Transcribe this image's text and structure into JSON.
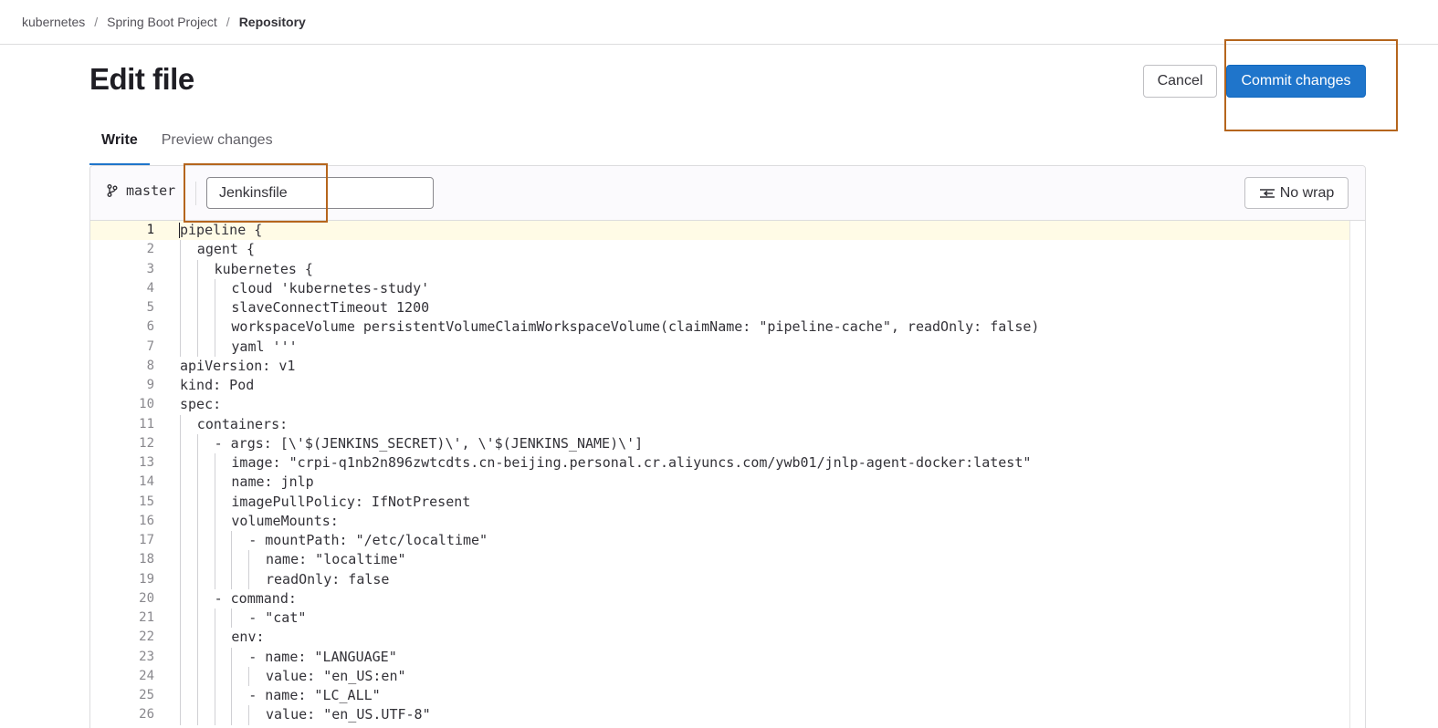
{
  "breadcrumb": {
    "items": [
      "kubernetes",
      "Spring Boot Project"
    ],
    "current": "Repository",
    "separator": "/"
  },
  "page": {
    "title": "Edit file"
  },
  "actions": {
    "cancel_label": "Cancel",
    "commit_label": "Commit changes"
  },
  "tabs": [
    {
      "label": "Write",
      "active": true
    },
    {
      "label": "Preview changes",
      "active": false
    }
  ],
  "editor": {
    "branch_icon": "branch-icon",
    "branch": "master",
    "filename": "Jenkinsfile",
    "wrap_label": "No wrap",
    "wrap_icon": "no-wrap-icon",
    "active_line": 1,
    "lines": [
      {
        "n": "1",
        "indent": 0,
        "text": "pipeline {"
      },
      {
        "n": "2",
        "indent": 1,
        "text": "agent {"
      },
      {
        "n": "3",
        "indent": 2,
        "text": "kubernetes {"
      },
      {
        "n": "4",
        "indent": 3,
        "text": "cloud 'kubernetes-study'"
      },
      {
        "n": "5",
        "indent": 3,
        "text": "slaveConnectTimeout 1200"
      },
      {
        "n": "6",
        "indent": 3,
        "text": "workspaceVolume persistentVolumeClaimWorkspaceVolume(claimName: \"pipeline-cache\", readOnly: false)"
      },
      {
        "n": "7",
        "indent": 3,
        "text": "yaml '''"
      },
      {
        "n": "8",
        "indent": 0,
        "text": "apiVersion: v1"
      },
      {
        "n": "9",
        "indent": 0,
        "text": "kind: Pod"
      },
      {
        "n": "10",
        "indent": 0,
        "text": "spec:"
      },
      {
        "n": "11",
        "indent": 1,
        "text": "containers:"
      },
      {
        "n": "12",
        "indent": 2,
        "text": "- args: [\\'$(JENKINS_SECRET)\\', \\'$(JENKINS_NAME)\\']"
      },
      {
        "n": "13",
        "indent": 3,
        "text": "image: \"crpi-q1nb2n896zwtcdts.cn-beijing.personal.cr.aliyuncs.com/ywb01/jnlp-agent-docker:latest\""
      },
      {
        "n": "14",
        "indent": 3,
        "text": "name: jnlp"
      },
      {
        "n": "15",
        "indent": 3,
        "text": "imagePullPolicy: IfNotPresent"
      },
      {
        "n": "16",
        "indent": 3,
        "text": "volumeMounts:"
      },
      {
        "n": "17",
        "indent": 4,
        "text": "- mountPath: \"/etc/localtime\""
      },
      {
        "n": "18",
        "indent": 5,
        "text": "name: \"localtime\""
      },
      {
        "n": "19",
        "indent": 5,
        "text": "readOnly: false"
      },
      {
        "n": "20",
        "indent": 2,
        "text": "- command:"
      },
      {
        "n": "21",
        "indent": 4,
        "text": "- \"cat\""
      },
      {
        "n": "22",
        "indent": 3,
        "text": "env:"
      },
      {
        "n": "23",
        "indent": 4,
        "text": "- name: \"LANGUAGE\""
      },
      {
        "n": "24",
        "indent": 5,
        "text": "value: \"en_US:en\""
      },
      {
        "n": "25",
        "indent": 4,
        "text": "- name: \"LC_ALL\""
      },
      {
        "n": "26",
        "indent": 5,
        "text": "value: \"en_US.UTF-8\""
      }
    ]
  },
  "colors": {
    "primary": "#1f75cb",
    "highlight": "#b5651d",
    "active_line_bg": "#fffbe6"
  }
}
